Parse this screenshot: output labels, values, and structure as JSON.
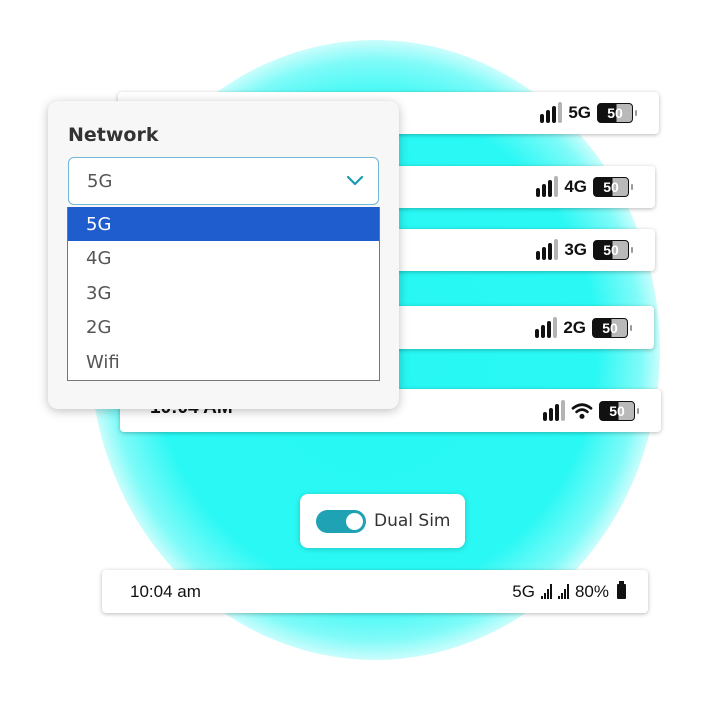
{
  "network_panel": {
    "title": "Network",
    "selected": "5G",
    "options": [
      "5G",
      "4G",
      "3G",
      "2G",
      "Wifi"
    ]
  },
  "status_bars": [
    {
      "network": "5G",
      "battery": "50"
    },
    {
      "network": "4G",
      "battery": "50"
    },
    {
      "network": "3G",
      "battery": "50"
    },
    {
      "network": "2G",
      "battery": "50"
    },
    {
      "time": "10:04 AM",
      "network": "wifi-icon",
      "battery": "50"
    }
  ],
  "toggle": {
    "label": "Dual Sim",
    "on": true
  },
  "dual_sim_bar": {
    "time": "10:04 am",
    "network": "5G",
    "battery": "80%"
  },
  "colors": {
    "glow": "#2af8f4",
    "selected_option": "#1f5ccd",
    "toggle": "#1fa2b4"
  }
}
